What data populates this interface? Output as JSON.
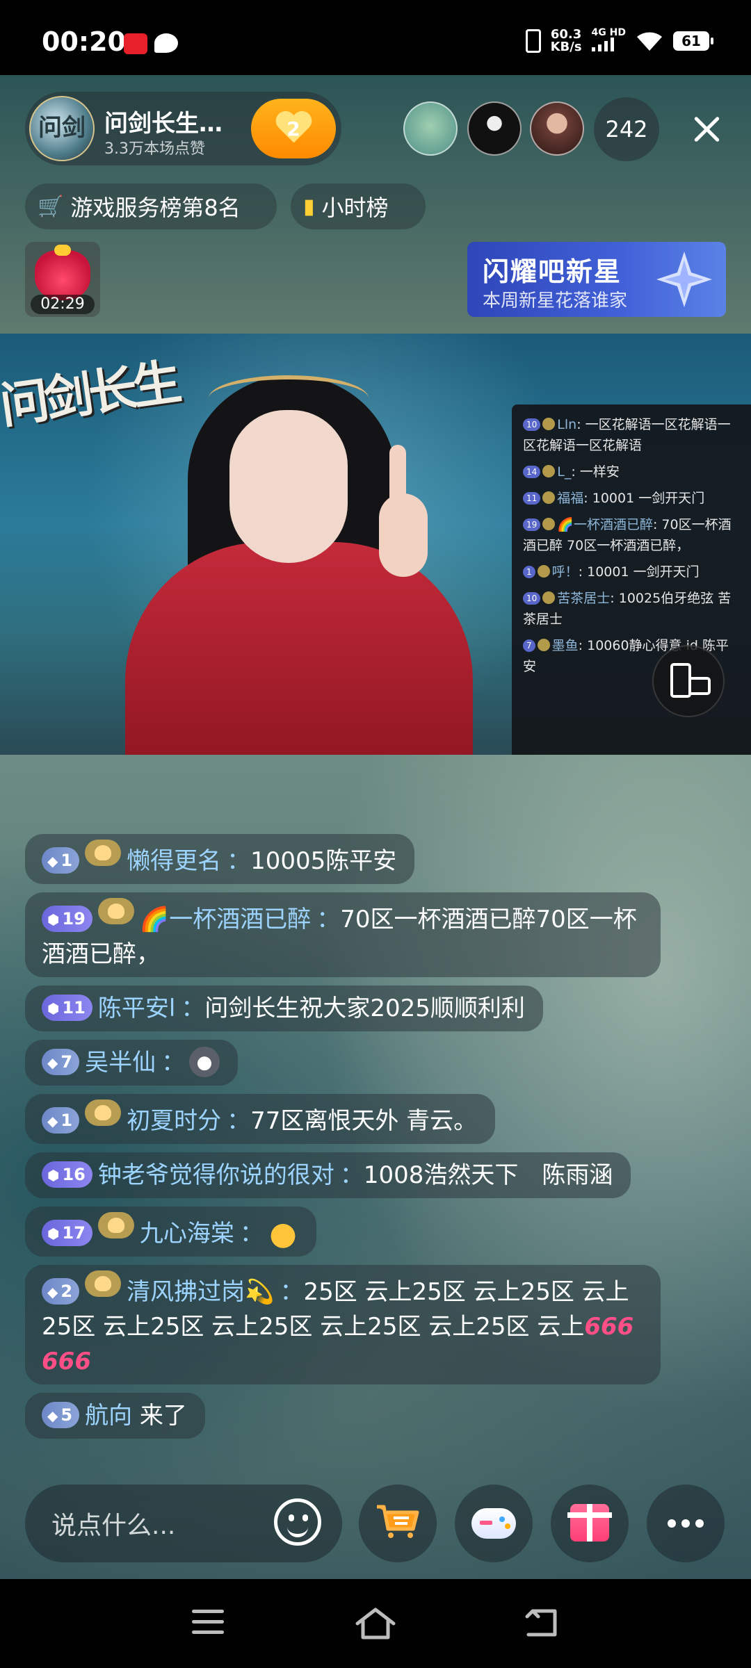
{
  "status_bar": {
    "time": "00:20",
    "net_speed_value": "60.3",
    "net_speed_unit": "KB/s",
    "network": "4G HD",
    "battery": "61"
  },
  "host": {
    "avatar_text": "问剑",
    "name": "问剑长生…",
    "likes": "3.3万本场点赞",
    "follow_count": "2"
  },
  "viewers": {
    "count": "242"
  },
  "pills": {
    "rank": "游戏服务榜第8名",
    "hourly": "小时榜"
  },
  "red_packet": {
    "timer": "02:29"
  },
  "promo": {
    "title": "闪耀吧新星",
    "subtitle": "本周新星花落谁家"
  },
  "video": {
    "logo_text": "问剑长生",
    "overlay_chat": [
      {
        "level": "10",
        "name": "Lln",
        "text": "一区花解语一区花解语一区花解语一区花解语"
      },
      {
        "level": "14",
        "name": "L_",
        "text": "一样安"
      },
      {
        "level": "11",
        "name": "福福",
        "text": "10001 一剑开天门"
      },
      {
        "level": "19",
        "name": "🌈一杯酒酒已醉",
        "text": "70区一杯酒酒已醉 70区一杯酒酒已醉，"
      },
      {
        "level": "1",
        "name": "呼！",
        "text": "10001 一剑开天门"
      },
      {
        "level": "10",
        "name": "苦茶居士",
        "text": "10025伯牙绝弦 苦茶居士"
      },
      {
        "level": "7",
        "name": "墨鱼",
        "text": "10060静心得意 id 陈平安"
      }
    ]
  },
  "chat": [
    {
      "level": "1",
      "fan": true,
      "name": "懒得更名",
      "sep": "：",
      "text": "10005陈平安"
    },
    {
      "level": "19",
      "fan": true,
      "name": "🌈一杯酒酒已醉",
      "sep": "：",
      "text": "70区一杯酒酒已醉70区一杯酒酒已醉，"
    },
    {
      "level": "11",
      "fan": false,
      "name": "陈平安l",
      "sep": "：",
      "text": "问剑长生祝大家2025顺顺利利"
    },
    {
      "level": "7",
      "fan": false,
      "name": "吴半仙",
      "sep": "：",
      "text": ""
    },
    {
      "level": "1",
      "fan": true,
      "name": "初夏时分",
      "sep": "：",
      "text": "77区离恨天外 青云。"
    },
    {
      "level": "16",
      "fan": false,
      "name": "钟老爷觉得你说的很对",
      "sep": "：",
      "text": "1008浩然天下　陈雨涵"
    },
    {
      "level": "17",
      "fan": true,
      "name": "九心海棠",
      "sep": "：",
      "text": ""
    },
    {
      "level": "2",
      "fan": true,
      "name": "清风拂过岗💫",
      "sep": "：",
      "text": "25区 云上25区 云上25区 云上25区 云上25区 云上25区 云上25区 云上25区 云上",
      "suffix": "666 666"
    },
    {
      "level": "5",
      "fan": false,
      "name": "航向",
      "sep": "",
      "text": "来了"
    }
  ],
  "input": {
    "placeholder": "说点什么..."
  },
  "colors": {
    "accent_orange": "#ff8a00",
    "username_blue": "#9dd4ff",
    "promo_blue": "#4261d8",
    "gift_pink": "#ff3f75"
  }
}
